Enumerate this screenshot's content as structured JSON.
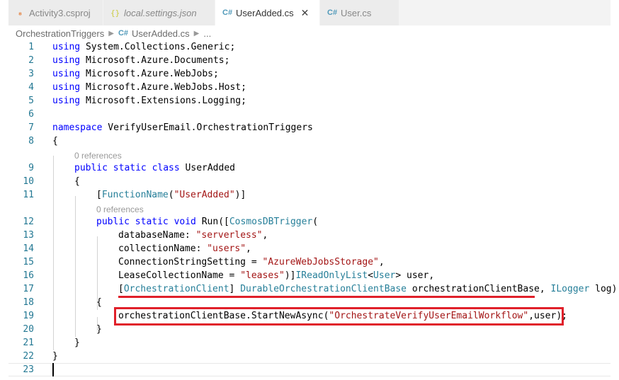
{
  "tabs": [
    {
      "label": "Activity3.csproj",
      "icon": "rss-icon",
      "active": false,
      "italic": false
    },
    {
      "label": "local.settings.json",
      "icon": "json-icon",
      "active": false,
      "italic": true
    },
    {
      "label": "UserAdded.cs",
      "icon": "csharp-icon",
      "active": true,
      "italic": false,
      "close": "✕"
    },
    {
      "label": "User.cs",
      "icon": "csharp-icon",
      "active": false,
      "italic": false
    }
  ],
  "breadcrumb": {
    "folder": "OrchestrationTriggers",
    "file": "UserAdded.cs",
    "more": "..."
  },
  "codelens": {
    "class_refs": "0 references",
    "method_refs": "0 references"
  },
  "editor": {
    "line_numbers": [
      "1",
      "2",
      "3",
      "4",
      "5",
      "6",
      "7",
      "8",
      "9",
      "10",
      "11",
      "12",
      "13",
      "14",
      "15",
      "16",
      "17",
      "18",
      "19",
      "20",
      "21",
      "22",
      "23"
    ],
    "lines": {
      "l1": {
        "kw": "using",
        "rest": " System.Collections.Generic;"
      },
      "l2": {
        "kw": "using",
        "rest": " Microsoft.Azure.Documents;"
      },
      "l3": {
        "kw": "using",
        "rest": " Microsoft.Azure.WebJobs;"
      },
      "l4": {
        "kw": "using",
        "rest": " Microsoft.Azure.WebJobs.Host;"
      },
      "l5": {
        "kw": "using",
        "rest": " Microsoft.Extensions.Logging;"
      },
      "l7": {
        "kw": "namespace",
        "rest": " VerifyUserEmail.OrchestrationTriggers"
      },
      "l8": {
        "text": "{"
      },
      "l9": {
        "kw": "public static class",
        "rest": " UserAdded"
      },
      "l10": {
        "text": "{"
      },
      "l11": {
        "open": "[",
        "type": "FunctionName",
        "p1": "(",
        "str": "\"UserAdded\"",
        "close": ")]"
      },
      "l12": {
        "kw": "public static void",
        "mid": " Run([",
        "type": "CosmosDBTrigger",
        "end": "("
      },
      "l13": {
        "pre": "databaseName: ",
        "str": "\"serverless\"",
        "post": ","
      },
      "l14": {
        "pre": "collectionName: ",
        "str": "\"users\"",
        "post": ","
      },
      "l15": {
        "pre": "ConnectionStringSetting = ",
        "str": "\"AzureWebJobsStorage\"",
        "post": ","
      },
      "l16": {
        "pre": "LeaseCollectionName = ",
        "str": "\"leases\"",
        "mid": ")]",
        "type": "IReadOnlyList",
        "lt": "<",
        "type2": "User",
        "post": "> user,"
      },
      "l17": {
        "open": "[",
        "type": "OrchestrationClient",
        "close": "] ",
        "type2": "DurableOrchestrationClientBase",
        "mid": " orchestrationClientBase, ",
        "type3": "ILogger",
        "post": " log)"
      },
      "l18": {
        "text": "{"
      },
      "l19": {
        "pre": "orchestrationClientBase.StartNewAsync(",
        "str": "\"OrchestrateVerifyUserEmailWorkflow\"",
        "post": ",user);"
      },
      "l20": {
        "text": "}"
      },
      "l21": {
        "text": "}"
      },
      "l22": {
        "text": "}"
      }
    }
  },
  "colors": {
    "keyword": "#0000ff",
    "type": "#267f99",
    "string": "#a31515",
    "line_number": "#237893",
    "highlight": "#e0202a"
  }
}
